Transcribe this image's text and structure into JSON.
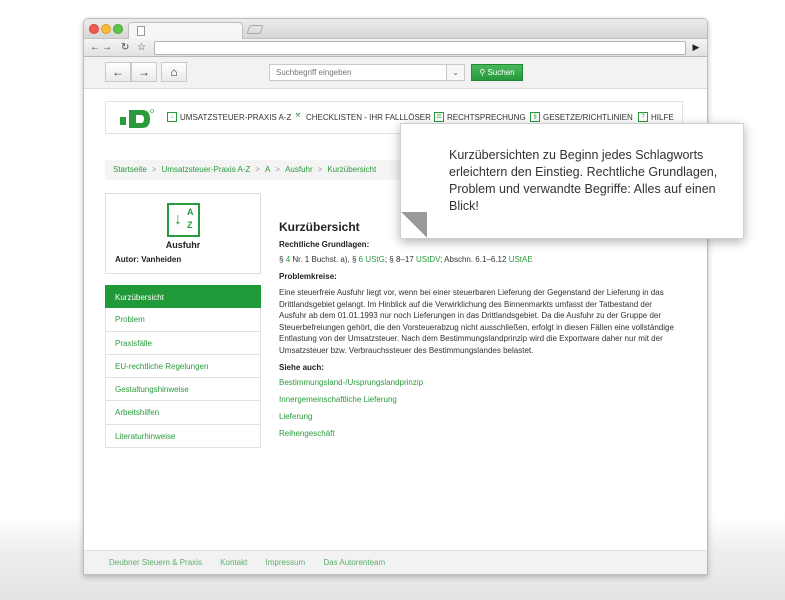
{
  "toolbar": {
    "search_placeholder": "Suchbegriff eingeben",
    "search_button": "Suchen"
  },
  "header": {
    "nav": [
      {
        "label": "UMSATZSTEUER-PRAXIS A-Z",
        "icon": "az-icon"
      },
      {
        "label": "CHECKLISTEN - IHR FALLLÖSER",
        "icon": "wrench-icon"
      },
      {
        "label": "RECHTSPRECHUNG",
        "icon": "court-icon"
      },
      {
        "label": "GESETZE/RICHTLINIEN",
        "icon": "paragraph-icon"
      },
      {
        "label": "HILFE",
        "icon": "help-icon"
      }
    ]
  },
  "breadcrumb": [
    "Startseite",
    "Umsatzsteuer-Praxis A-Z",
    "A",
    "Ausfuhr",
    "Kurzübersicht"
  ],
  "entry": {
    "title": "Ausfuhr",
    "author": "Autor: Vanheiden"
  },
  "sidenav": [
    {
      "label": "Kurzübersicht",
      "active": true
    },
    {
      "label": "Problem",
      "active": false
    },
    {
      "label": "Praxisfälle",
      "active": false
    },
    {
      "label": "EU-rechtliche Regelungen",
      "active": false
    },
    {
      "label": "Gestaltungshinweise",
      "active": false
    },
    {
      "label": "Arbeitshilfen",
      "active": false
    },
    {
      "label": "Literaturhinweise",
      "active": false
    }
  ],
  "content": {
    "heading": "Kurzübersicht",
    "legal_heading": "Rechtliche Grundlagen:",
    "law": {
      "p1": "§",
      "l1": "4",
      "t1": " Nr. 1 Buchst. a), §",
      "l2": "6 UStG",
      "t2": "; § 8–17",
      "l3": "UStDV",
      "t3": "; Abschn. 6.1–6.12",
      "l4": "UStAE"
    },
    "problem_heading": "Problemkreise:",
    "problem_text": "Eine steuerfreie Ausfuhr liegt vor, wenn bei einer steuerbaren Lieferung der Gegenstand der Lieferung in das Drittlandsgebiet gelangt. Im Hinblick auf die Verwirklichung des Binnenmarkts umfasst der Tatbestand der Ausfuhr ab dem 01.01.1993 nur noch Lieferungen in das Drittlandsgebiet. Da die Ausfuhr zu der Gruppe der Steuerbefreiungen gehört, die den Vorsteuerabzug nicht ausschließen, erfolgt in diesen Fällen eine vollständige Entlastung von der Umsatzsteuer. Nach dem Bestimmungslandprinzip wird die Exportware daher nur mit der Umsatzsteuer bzw. Verbrauchssteuer des Bestimmungslandes belastet.",
    "see_heading": "Siehe auch:",
    "see_links": [
      "Bestimmungsland-/Ursprungslandprinzip",
      "Innergemeinschaftliche Lieferung",
      "Lieferung",
      "Reihengeschäft"
    ]
  },
  "footer": [
    "Deubner Steuern & Praxis",
    "Kontakt",
    "Impressum",
    "Das Autorenteam"
  ],
  "callout": {
    "text": "Kurzübersichten zu Beginn jedes Schlagworts erleichtern den Einstieg. Rechtliche Grundlagen, Problem und verwandte Begriffe: Alles auf einen Blick!"
  },
  "colors": {
    "brand_green": "#2a9a3c",
    "active_green": "#209a38"
  }
}
